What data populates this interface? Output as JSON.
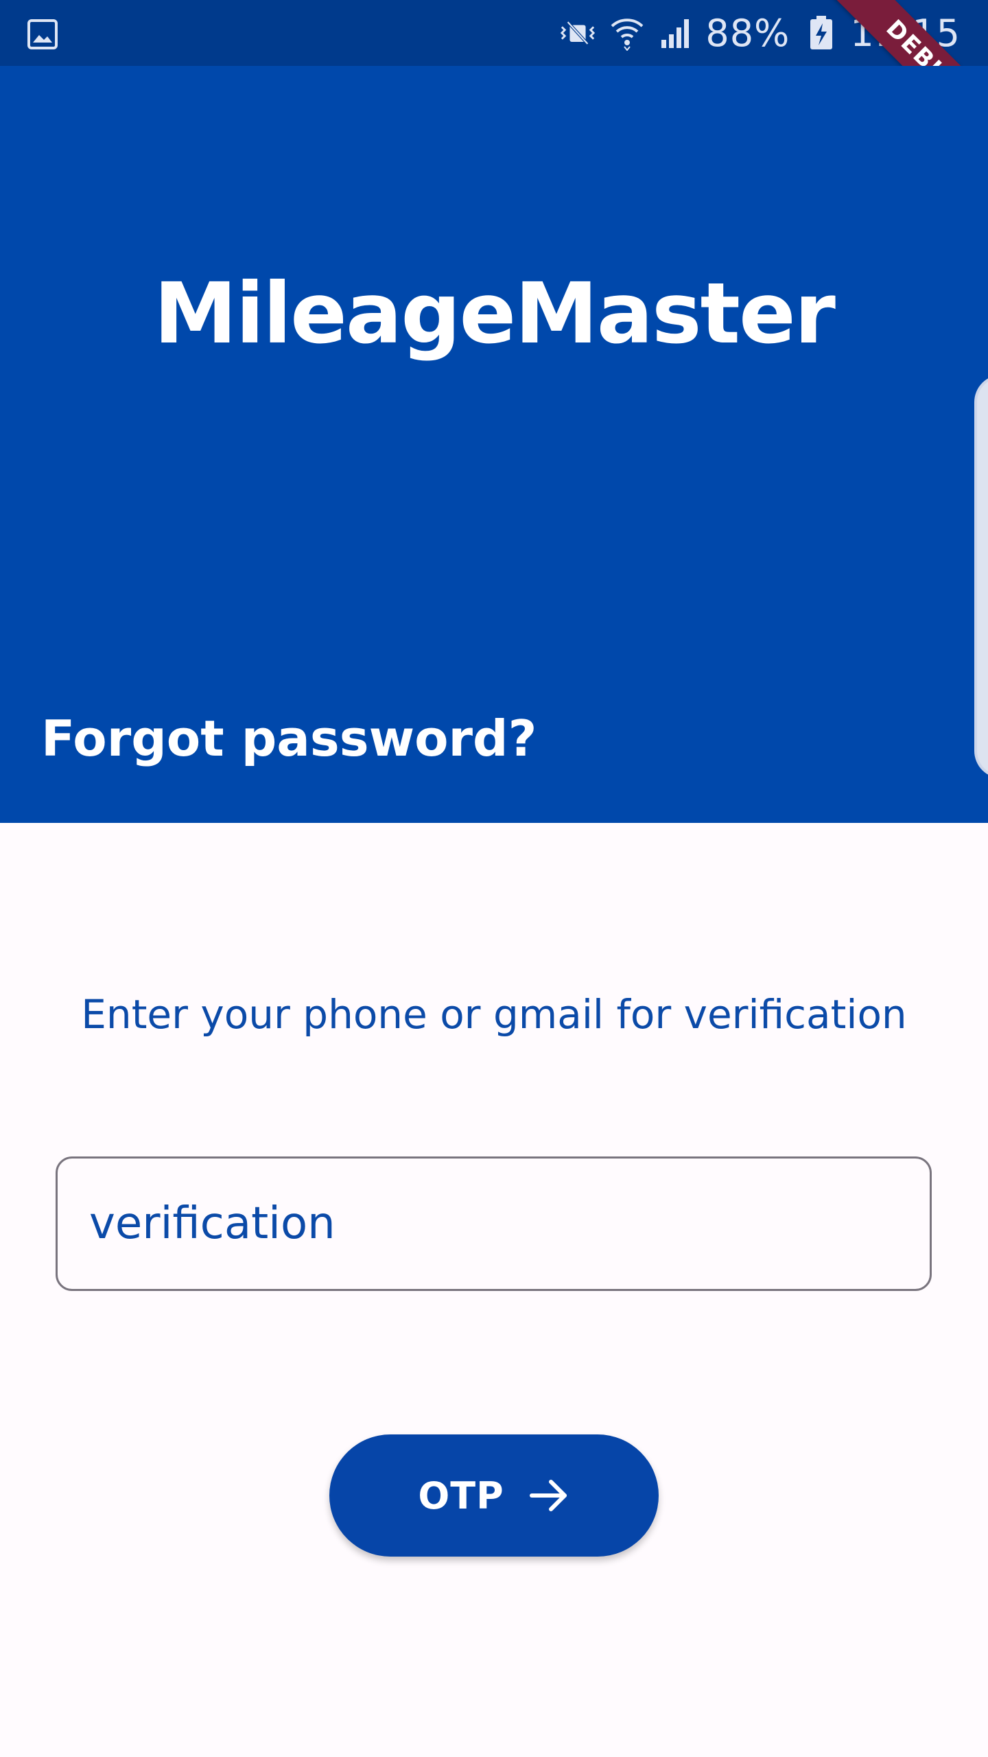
{
  "status_bar": {
    "icons": [
      "gallery-icon",
      "vibrate-off-icon",
      "wifi-icon",
      "cellular-signal-icon",
      "battery-charging-icon"
    ],
    "battery_percent": "88%",
    "time": "11:15"
  },
  "debug_banner": {
    "label": "DEBUG"
  },
  "header": {
    "app_title": "MileageMaster",
    "page_title": "Forgot password?"
  },
  "form": {
    "instructions": "Enter your phone or gmail for verification",
    "input_value": "verification",
    "submit_label": "OTP",
    "submit_icon": "arrow-right-icon"
  },
  "colors": {
    "status_bar": "#003a8c",
    "header": "#0048ab",
    "accent_text": "#0b4aa8",
    "button": "#0645a8",
    "page_background": "#fffbfe",
    "debug_banner": "#7a1d3b"
  }
}
